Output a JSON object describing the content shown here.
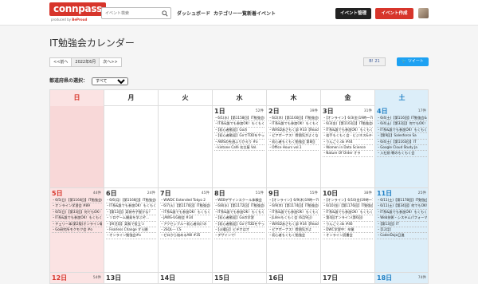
{
  "header": {
    "logo": "connpass",
    "logo_sub_prefix": "produced by ",
    "logo_sub_brand": "BeProud",
    "search_placeholder": "イベント検索",
    "nav": [
      "ダッシュボード",
      "カテゴリー一覧",
      "新着イベント"
    ],
    "btn_manage": "イベント管理",
    "btn_create": "イベント作成"
  },
  "page": {
    "title": "IT勉強会カレンダー",
    "prev": "<<前へ",
    "current": "2022年6月",
    "next": "次へ>>",
    "bookmark": "21",
    "tweet": "ツイート",
    "pref_label": "都道府県の選択：",
    "pref_value": "すべて"
  },
  "calendar": {
    "weekdays": [
      "日",
      "月",
      "火",
      "水",
      "木",
      "金",
      "土"
    ],
    "weeks": [
      [
        {
          "day": "",
          "count": "",
          "events": []
        },
        {
          "day": "",
          "count": "",
          "events": []
        },
        {
          "day": "",
          "count": "",
          "events": []
        },
        {
          "day": "1日",
          "count": "52件",
          "events": [
            "・6/1(水)【第1158回】IT勉強会&オ",
            "・IT系&誰でも参加OK！もくもく会 朝活",
            "・【初心者歓迎】Goの ",
            "・【初心者歓迎】GoでTDDをやってみよう#o",
            "・AWSの先週ふりかえり #o",
            "・kintone Café 名古屋 Vol."
          ]
        },
        {
          "day": "2日",
          "count": "39件",
          "events": [
            "・6/2(木)【第1160回】IT勉強会&オ",
            "・IT系&誰でも参加OK！もくもく会 朝活",
            "・WASDあさもく部 #33【React",
            "・ピアボーナス！雰囲気がよくなってい",
            "・初心者もくもく勉強会 第8回",
            "・Office Hours vol.1"
          ]
        },
        {
          "day": "3日",
          "count": "31件",
          "events": [
            "・【オンライン】6/3(金)19時〜7時：RI",
            "・6/3(金)【第1161回】IT勉強会&オ",
            "・IT系&誰でも参加OK！もくもく会 朝活",
            "・若手もくもく会 - ビジネス&テクノロジー",
            "・りんごぐ.dx #44",
            "・Women in Data Science",
            "・Nature Of Order オラ"
          ]
        },
        {
          "day": "4日",
          "count": "17件",
          "events": [
            "・6/4(土)【第116回】IT勉強会&オ",
            "・6/4(土)【第32回】何でもOK！フリー",
            "・IT系&誰でも参加OK！もくもく会 朝活",
            "・【第9回】Salesforce Sa",
            "・6/4(土)【第1163回】IT",
            "・Google Cloud Study Ja",
            "・入社前 朝のもくもく会"
          ]
        }
      ],
      [
        {
          "day": "5日",
          "count": "44件",
          "events": [
            "・6/5(日)【第1164回】IT勉強会&オ",
            "・オンライン学習会 #89",
            "・6/5(日)【第33回】何でもOK！フリー",
            "・IT系&誰でも参加OK！もくもく会 朝活",
            "・チェリー本(第2版)オンライン輪読会#",
            "・Go研究所モクモク会 #o"
          ]
        },
        {
          "day": "6日",
          "count": "24件",
          "events": [
            "・6/6(月)【第1166回】IT勉強会&オ",
            "・IT系&誰でも参加OK！もくもく会 朝活",
            "・【第13回】実装寺子屋かな？",
            "・ソロゲーム開発を学ぶぞ...",
            "・【AI活用】実務で役立つ",
            "・Fearless Change ずら開",
            "・オンライン勉強会#o"
          ]
        },
        {
          "day": "7日",
          "count": "45件",
          "events": [
            "・WWDC Extended Tokyo 2",
            "・6/7(火)【第1170回】IT勉強会&オ",
            "・IT系&誰でも参加OK！もくもく会 朝活",
            "・JAWS-UG総会 #34",
            "・アクセシブルー初心者向けの",
            "・2SQL--- CS",
            "・ゼロから始めるAW #35"
          ]
        },
        {
          "day": "8日",
          "count": "51件",
          "events": [
            "・WEBデザインスクール体験会",
            "・6/8(水)【第1172回】IT勉強会&オ",
            "・IT系&誰でも参加OK！もくもく会 朝活",
            "・【初心者歓迎】Goの学習",
            "・【初心者歓迎】GoでTDDをやってみよう#o",
            "・【火曜日】ビデオはオ",
            "・デザインで!"
          ]
        },
        {
          "day": "9日",
          "count": "55件",
          "events": [
            "・【オンライン】6/9(木)19時〜7時：RI",
            "・6/9(木)【第1174回】IT勉強会&オ",
            "・IT系&誰でも参加OK！もくもく会 朝活",
            "・JLdevもくもく会 (6月9日)",
            "・WASDあさもく部 #34【React",
            "・ピアボーナス！雰囲気がよ",
            "・初心者もくもく勉強会"
          ]
        },
        {
          "day": "10日",
          "count": "38件",
          "events": [
            "・【オンライン】6/10(金)19時〜7時：RI",
            "・6/10(金)【第1176回】IT勉強会&オ",
            "・IT系&誰でも参加OK！もくもく会 朝活",
            "・第4回オンライン(第6回)",
            "・りんごぐ.dx #46",
            "・DWC学習中：卒業",
            "・オンライン読書会"
          ]
        },
        {
          "day": "11日",
          "count": "25件",
          "events": [
            "・6/11(土)【第1178回】IT勉強会&オ",
            "・6/11(土)【第34回】何でもOK！フリー",
            "・IT系&誰でも参加OK！もくもく会 朝活",
            "・Web技術・システムパフォーマンス",
            "・【第13回】IT",
            "・【12月】",
            "・CoderDojo日進"
          ]
        }
      ],
      [
        {
          "day": "12日",
          "count": "54件",
          "events": []
        },
        {
          "day": "13日",
          "count": "",
          "events": []
        },
        {
          "day": "14日",
          "count": "",
          "events": []
        },
        {
          "day": "15日",
          "count": "",
          "events": []
        },
        {
          "day": "16日",
          "count": "",
          "events": []
        },
        {
          "day": "17日",
          "count": "",
          "events": []
        },
        {
          "day": "18日",
          "count": "74件",
          "events": []
        }
      ]
    ]
  }
}
